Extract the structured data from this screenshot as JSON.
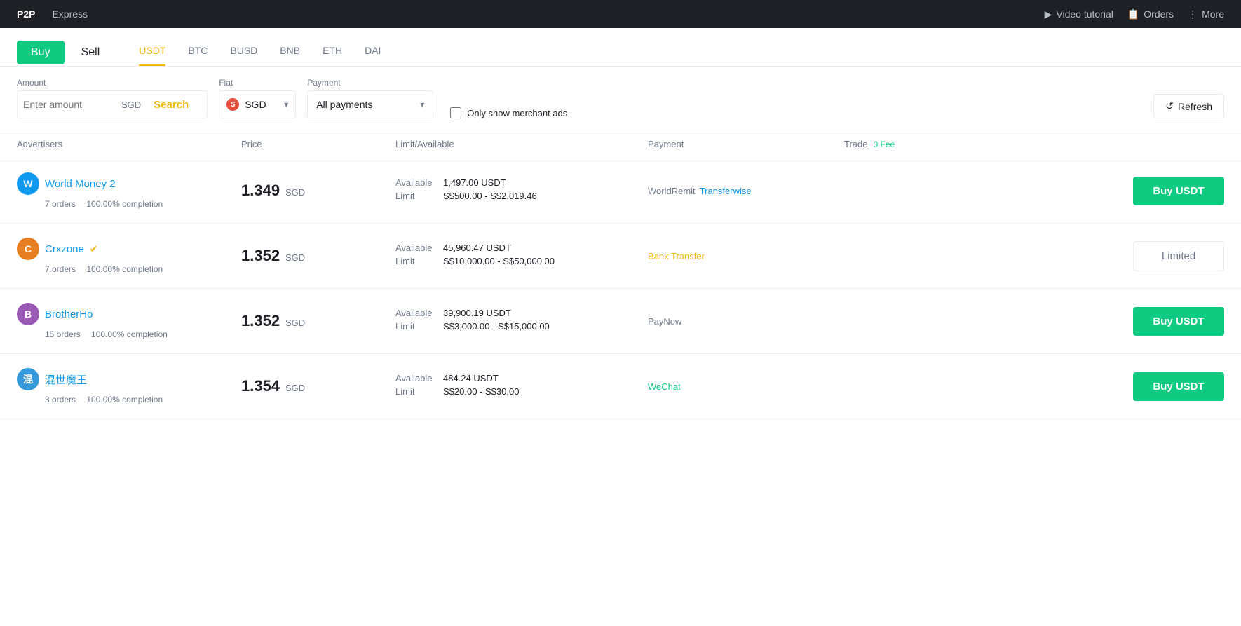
{
  "topNav": {
    "leftItems": [
      {
        "label": "P2P",
        "active": true
      },
      {
        "label": "Express",
        "active": false
      }
    ],
    "rightItems": [
      {
        "label": "Video tutorial",
        "icon": "▶"
      },
      {
        "label": "Orders",
        "icon": "📄"
      },
      {
        "label": "More",
        "icon": "⋮"
      }
    ]
  },
  "bsTabs": {
    "buy": "Buy",
    "sell": "Sell"
  },
  "currencyTabs": [
    "USDT",
    "BTC",
    "BUSD",
    "BNB",
    "ETH",
    "DAI"
  ],
  "activeCurrency": "USDT",
  "filters": {
    "amountPlaceholder": "Enter amount",
    "amountCurrency": "SGD",
    "searchLabel": "Search",
    "fiatLabel": "Fiat",
    "fiatCurrency": "SGD",
    "paymentLabel": "Payment",
    "paymentValue": "All payments",
    "merchantLabel": "Only show merchant ads",
    "refreshLabel": "Refresh"
  },
  "tableHeaders": {
    "advertisers": "Advertisers",
    "price": "Price",
    "limitAvailable": "Limit/Available",
    "payment": "Payment",
    "trade": "Trade",
    "feeBadge": "0 Fee"
  },
  "rows": [
    {
      "id": 1,
      "avatarLetter": "W",
      "avatarClass": "avatar-w",
      "name": "World Money 2",
      "verified": false,
      "orders": "7 orders",
      "completion": "100.00% completion",
      "price": "1.349",
      "priceCurrency": "SGD",
      "available": "1,497.00 USDT",
      "limitMin": "S$500.00",
      "limitMax": "S$2,019.46",
      "payments": [
        {
          "label": "WorldRemit",
          "class": "payment-tag-worldremit"
        },
        {
          "label": "Transferwise",
          "class": "payment-tag-transferwise"
        }
      ],
      "tradeBtn": "Buy USDT",
      "tradeBtnType": "buy"
    },
    {
      "id": 2,
      "avatarLetter": "C",
      "avatarClass": "avatar-c",
      "name": "Crxzone",
      "verified": true,
      "orders": "7 orders",
      "completion": "100.00% completion",
      "price": "1.352",
      "priceCurrency": "SGD",
      "available": "45,960.47 USDT",
      "limitMin": "S$10,000.00",
      "limitMax": "S$50,000.00",
      "payments": [
        {
          "label": "Bank Transfer",
          "class": "payment-tag-bank"
        }
      ],
      "tradeBtn": "Limited",
      "tradeBtnType": "limited"
    },
    {
      "id": 3,
      "avatarLetter": "B",
      "avatarClass": "avatar-b",
      "name": "BrotherHo",
      "verified": false,
      "orders": "15 orders",
      "completion": "100.00% completion",
      "price": "1.352",
      "priceCurrency": "SGD",
      "available": "39,900.19 USDT",
      "limitMin": "S$3,000.00",
      "limitMax": "S$15,000.00",
      "payments": [
        {
          "label": "PayNow",
          "class": "payment-tag-paynow"
        }
      ],
      "tradeBtn": "Buy USDT",
      "tradeBtnType": "buy"
    },
    {
      "id": 4,
      "avatarLetter": "混",
      "avatarClass": "avatar-mix",
      "name": "混世魔王",
      "verified": false,
      "orders": "3 orders",
      "completion": "100.00% completion",
      "price": "1.354",
      "priceCurrency": "SGD",
      "available": "484.24 USDT",
      "limitMin": "S$20.00",
      "limitMax": "S$30.00",
      "payments": [
        {
          "label": "WeChat",
          "class": "payment-tag-wechat"
        }
      ],
      "tradeBtn": "Buy USDT",
      "tradeBtnType": "buy"
    }
  ]
}
